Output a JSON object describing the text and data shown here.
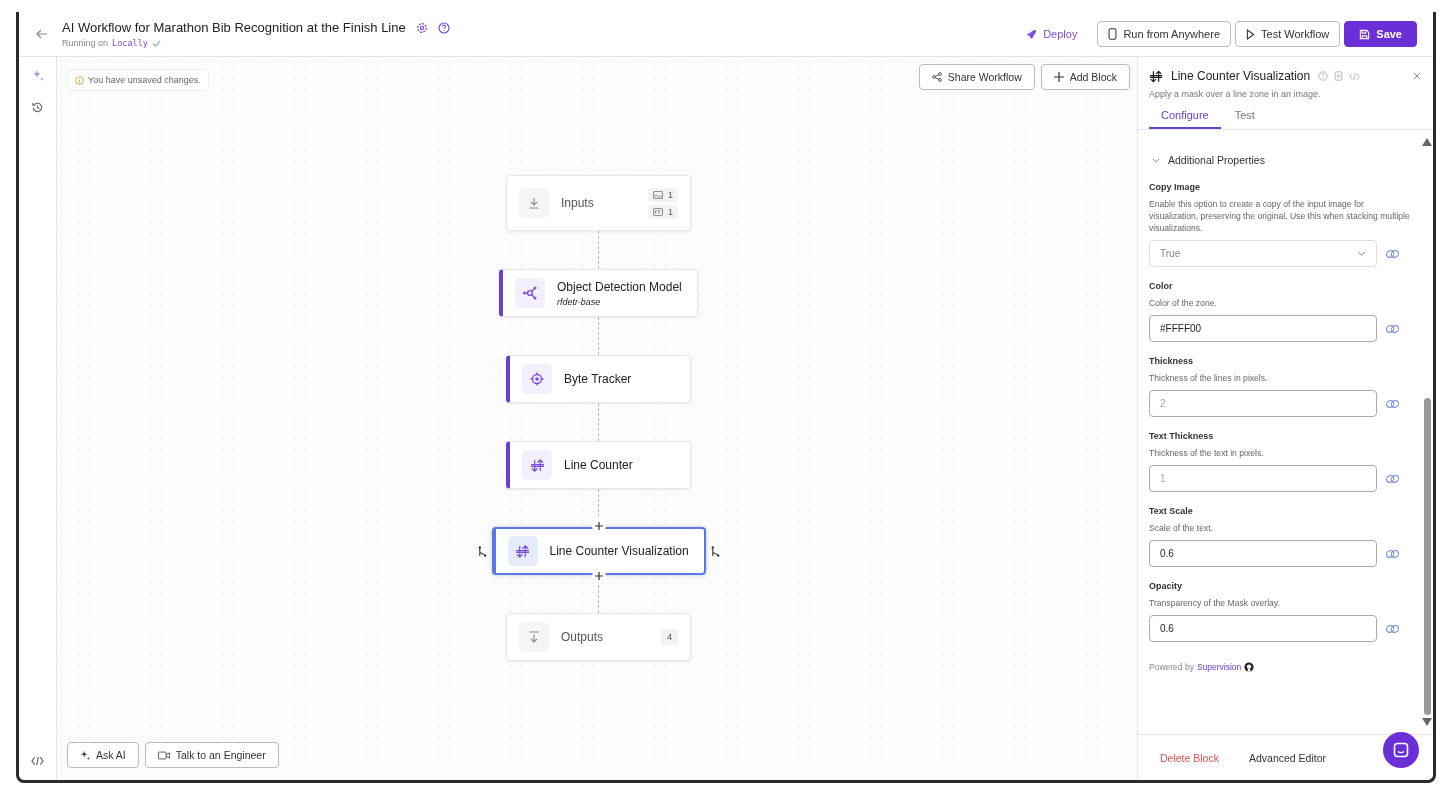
{
  "header": {
    "title": "AI Workflow for Marathon Bib Recognition at the Finish Line",
    "running_label": "Running on",
    "runtime": "Locally",
    "deploy": "Deploy",
    "buttons": [
      {
        "kind": "device",
        "label": "Run from Anywhere"
      },
      {
        "kind": "play",
        "label": "Test Workflow"
      },
      {
        "kind": "save",
        "label": "Save"
      }
    ]
  },
  "canvas": {
    "notice": "You have unsaved changes.",
    "toolbar": [
      {
        "kind": "share",
        "label": "Share Workflow"
      },
      {
        "kind": "add",
        "label": "Add Block"
      }
    ],
    "nodes": [
      {
        "kind": "input",
        "name": "Inputs",
        "selected": false,
        "badges": [
          "1",
          "1"
        ]
      },
      {
        "kind": "model",
        "name": "Object Detection Model",
        "subtitle": "rfdetr-base",
        "selected": false
      },
      {
        "kind": "tracker",
        "name": "Byte Tracker",
        "selected": false
      },
      {
        "kind": "counter",
        "name": "Line Counter",
        "selected": false
      },
      {
        "kind": "counter",
        "name": "Line Counter Visualization",
        "selected": true
      },
      {
        "kind": "output",
        "name": "Outputs",
        "selected": false,
        "count": "4"
      }
    ],
    "bottom_buttons": [
      {
        "kind": "ai",
        "label": "Ask AI"
      },
      {
        "kind": "video",
        "label": "Talk to an Engineer"
      }
    ]
  },
  "panel": {
    "title": "Line Counter Visualization",
    "description": "Apply a mask over a line zone in an image.",
    "tabs": [
      {
        "label": "Configure",
        "selected": true
      },
      {
        "label": "Test",
        "selected": false
      }
    ],
    "section": {
      "label": "Additional Properties",
      "expanded": true
    },
    "fields": [
      {
        "kind": "select",
        "label": "Copy Image",
        "description": "Enable this option to create a copy of the input image for visualization, preserving the original. Use this when stacking multiple visualizations.",
        "value": "True"
      },
      {
        "kind": "input",
        "label": "Color",
        "description": "Color of the zone.",
        "value": "#FFFF00"
      },
      {
        "kind": "input",
        "label": "Thickness",
        "description": "Thickness of the lines in pixels.",
        "placeholder": "2"
      },
      {
        "kind": "input",
        "label": "Text Thickness",
        "description": "Thickness of the text in pixels.",
        "placeholder": "1"
      },
      {
        "kind": "input",
        "label": "Text Scale",
        "description": "Scale of the text.",
        "value": "0.6"
      },
      {
        "kind": "input",
        "label": "Opacity",
        "description": "Transparency of the Mask overlay.",
        "value": "0.6"
      }
    ],
    "powered_by": "Powered by",
    "powered_link": "Supervision",
    "footer": [
      {
        "kind": "danger",
        "label": "Delete Block"
      },
      {
        "kind": "plain",
        "label": "Advanced Editor"
      }
    ]
  }
}
